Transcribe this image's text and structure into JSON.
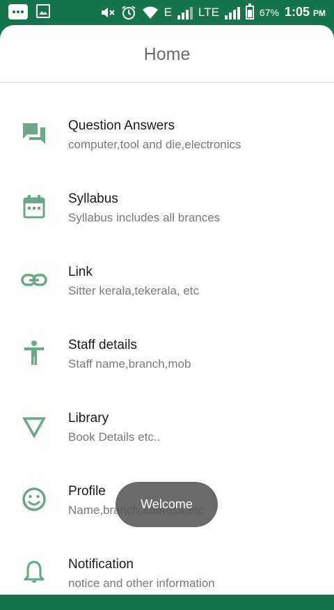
{
  "status_bar": {
    "network_label": "E",
    "lte_label": "LTE",
    "battery_percent": "67%",
    "time": "1:05",
    "ampm": "PM"
  },
  "header": {
    "title": "Home"
  },
  "menu": [
    {
      "title": "Question Answers",
      "subtitle": "computer,tool and die,electronics",
      "icon": "forum-icon"
    },
    {
      "title": "Syllabus",
      "subtitle": "Syllabus includes all brances",
      "icon": "calendar-icon"
    },
    {
      "title": "Link",
      "subtitle": "Sitter kerala,tekerala, etc",
      "icon": "link-icon"
    },
    {
      "title": "Staff details",
      "subtitle": "Staff name,branch,mob",
      "icon": "accessibility-icon"
    },
    {
      "title": "Library",
      "subtitle": "Book Details etc..",
      "icon": "triangle-down-icon"
    },
    {
      "title": "Profile",
      "subtitle": "Name,branch,address,etc",
      "icon": "smiley-icon"
    },
    {
      "title": "Notification",
      "subtitle": "notice and other information",
      "icon": "bell-icon"
    }
  ],
  "toast": {
    "text": "Welcome"
  },
  "colors": {
    "accent": "#16744c",
    "icon": "#6aa88a"
  }
}
